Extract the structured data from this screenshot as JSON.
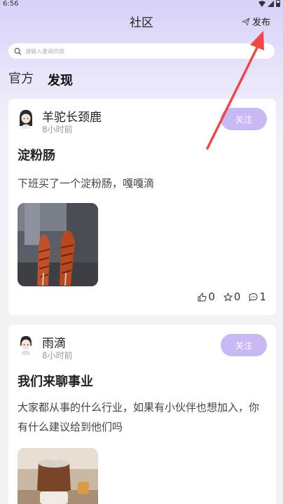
{
  "status_bar": {
    "time": "6:56"
  },
  "header": {
    "title": "社区",
    "publish_label": "发布",
    "publish_icon": "send-icon"
  },
  "search": {
    "placeholder": "请输入查询内容"
  },
  "tabs": [
    {
      "label": "官方",
      "active": false
    },
    {
      "label": "发现",
      "active": true
    }
  ],
  "posts": [
    {
      "username": "羊驼长颈鹿",
      "time": "8小时前",
      "follow_label": "关注",
      "title": "淀粉肠",
      "body": "下班买了一个淀粉肠，嘎嘎滴",
      "image": "fried-starch-sausage-photo",
      "likes": "0",
      "favorites": "0",
      "comments": "1"
    },
    {
      "username": "雨滴",
      "time": "8小时前",
      "follow_label": "关注",
      "title": "我们来聊事业",
      "body": "大家都从事的什么行业，如果有小伙伴也想加入，你有什么建议给到他们吗",
      "image": "tea-set-photo"
    }
  ],
  "colors": {
    "accent": "#c8b9f5",
    "annotation_arrow": "#f04848",
    "header_gradient": "#d7d0f7"
  }
}
